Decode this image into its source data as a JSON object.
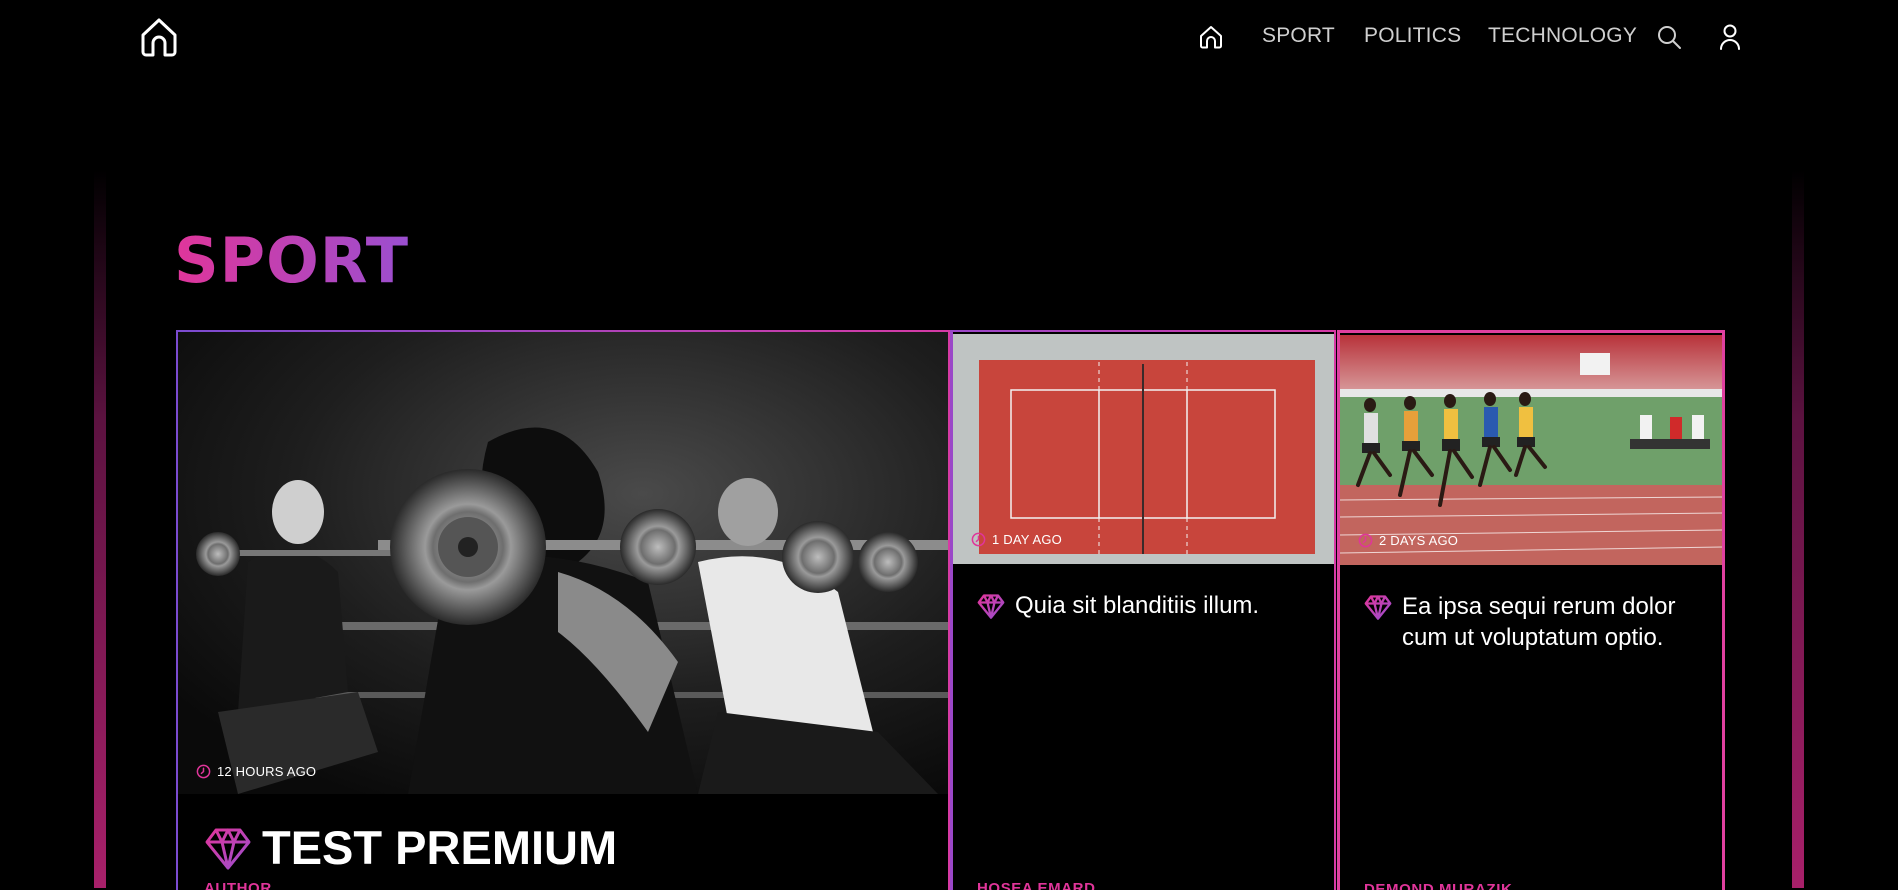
{
  "nav": {
    "logo_icon": "home-outline-icon",
    "home_icon": "home-icon",
    "links": [
      "SPORT",
      "POLITICS",
      "TECHNOLOGY"
    ],
    "search_icon": "search-icon",
    "user_icon": "user-icon"
  },
  "section": {
    "title": "SPORT"
  },
  "cards": [
    {
      "image": "weightlifting-class-photo",
      "time": "12 HOURS AGO",
      "title": "TEST PREMIUM",
      "premium_icon": "diamond-icon",
      "author": "AUTHOR"
    },
    {
      "image": "red-court-aerial-photo",
      "time": "1 DAY AGO",
      "title": "Quia sit blanditiis illum.",
      "premium_icon": "diamond-icon",
      "author": "HOSEA EMARD"
    },
    {
      "image": "sprinters-track-photo",
      "time": "2 DAYS AGO",
      "title": "Ea ipsa sequi rerum dolor cum ut voluptatum optio.",
      "premium_icon": "diamond-icon",
      "author": "DEMOND MURAZIK"
    }
  ],
  "colors": {
    "accent_pink": "#e0359a",
    "accent_purple": "#9a4fd0",
    "background": "#000000"
  }
}
